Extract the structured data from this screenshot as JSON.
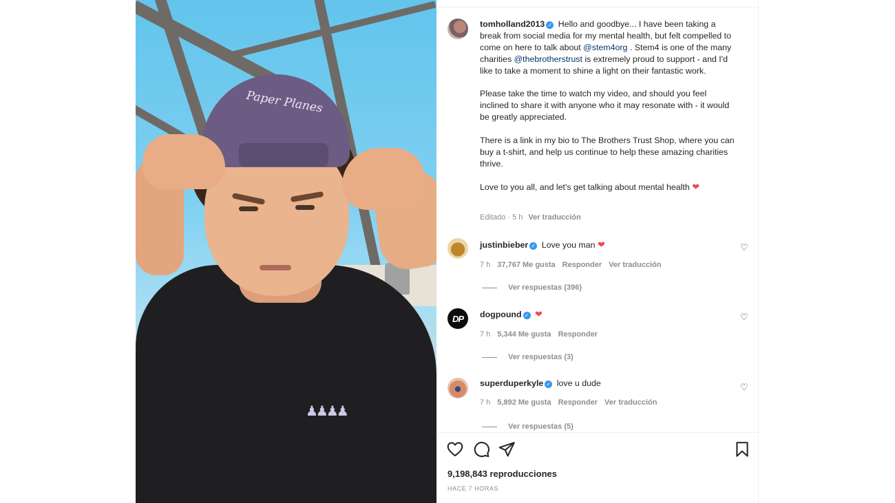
{
  "photo": {
    "cap_text": "Paper Planes",
    "shirt_logo": "♟♟♟♟"
  },
  "post": {
    "username": "tomholland2013",
    "caption_paragraphs": [
      {
        "before_mention_1": "Hello and goodbye... I have been taking a break from social media for my mental health, but felt compelled to come on here to talk about ",
        "mention_1": "@stem4org",
        "between": " . Stem4 is one of the many charities ",
        "mention_2": "@thebrotherstrust",
        "after": " is extremely proud to support - and I'd like to take a moment to shine a light on their fantastic work."
      }
    ],
    "paragraph_2": "Please take the time to watch my video, and should you feel inclined to share it with anyone who it may resonate with - it would be greatly appreciated.",
    "paragraph_3": "There is a link in my bio to The Brothers Trust Shop, where you can buy a t-shirt, and help us continue to help these amazing charities thrive.",
    "paragraph_4": "Love to you all, and let's get talking about mental health",
    "heart": "❤",
    "edited": "Editado · 5 h",
    "translate": "Ver traducción"
  },
  "comments": [
    {
      "username": "justinbieber",
      "text": "Love you man",
      "heart": "❤",
      "time": "7 h",
      "likes": "37,767 Me gusta",
      "reply": "Responder",
      "translate": "Ver traducción",
      "replies": "Ver respuestas (396)"
    },
    {
      "username": "dogpound",
      "text": "",
      "heart": "❤",
      "avatar_text": "DP",
      "time": "7 h",
      "likes": "5,344 Me gusta",
      "reply": "Responder",
      "replies": "Ver respuestas (3)"
    },
    {
      "username": "superduperkyle",
      "text": "love u dude",
      "time": "7 h",
      "likes": "5,892 Me gusta",
      "reply": "Responder",
      "translate": "Ver traducción",
      "replies": "Ver respuestas (5)"
    }
  ],
  "footer": {
    "views": "9,198,843 reproducciones",
    "time_ago": "HACE 7 HORAS"
  },
  "icons": {
    "verified": "✓",
    "small_heart": "♡"
  },
  "colors": {
    "verified_blue": "#3897f0",
    "heart_red": "#ed4956",
    "mention_blue": "#00376b",
    "muted_gray": "#8e8e8e"
  }
}
